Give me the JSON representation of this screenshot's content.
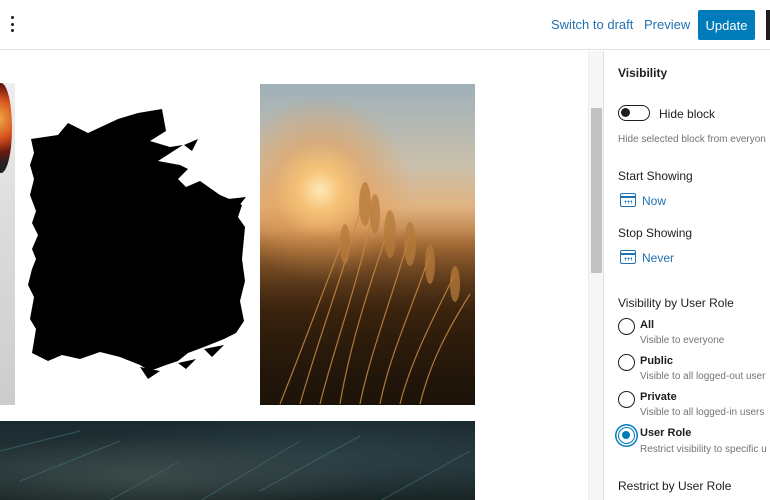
{
  "toolbar": {
    "switch_to_draft": "Switch to draft",
    "preview": "Preview",
    "update": "Update",
    "more_icon": "vertical-ellipsis-icon"
  },
  "sidebar": {
    "section_title": "Visibility",
    "hide_block": {
      "label": "Hide block",
      "help": "Hide selected block from everyon",
      "enabled": false
    },
    "start_showing": {
      "label": "Start Showing",
      "value": "Now",
      "icon": "calendar-icon"
    },
    "stop_showing": {
      "label": "Stop Showing",
      "value": "Never",
      "icon": "calendar-icon"
    },
    "user_role": {
      "heading": "Visibility by User Role",
      "options": [
        {
          "label": "All",
          "help": "Visible to everyone",
          "checked": false
        },
        {
          "label": "Public",
          "help": "Visible to all logged-out user",
          "checked": false
        },
        {
          "label": "Private",
          "help": "Visible to all logged-in users",
          "checked": false
        },
        {
          "label": "User Role",
          "help": "Restrict visibility to specific u",
          "checked": true
        }
      ]
    },
    "restrict_heading": "Restrict by User Role"
  },
  "colors": {
    "accent": "#007cba",
    "link": "#2271b1"
  }
}
